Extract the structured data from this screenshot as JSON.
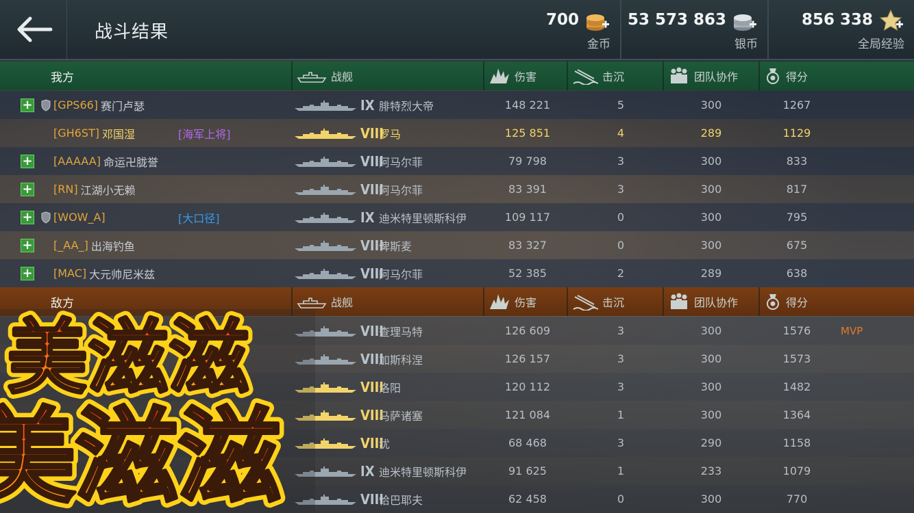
{
  "header": {
    "title": "战斗结果",
    "gold": {
      "amount": "700",
      "label": "金币"
    },
    "silver": {
      "amount": "53 573 863",
      "label": "银币"
    },
    "xp": {
      "amount": "856 338",
      "label": "全局经验"
    }
  },
  "columns": {
    "ship": "战舰",
    "damage": "伤害",
    "kills": "击沉",
    "team": "团队协作",
    "score": "得分"
  },
  "ally": {
    "team_label": "我方",
    "rows": [
      {
        "clan": "[GPS66]",
        "name": "赛门卢瑟",
        "rank": "",
        "tier": "IX",
        "ship": "腓特烈大帝",
        "damage": "148 221",
        "kills": "5",
        "team": "300",
        "score": "1267",
        "plus": true,
        "shield": true
      },
      {
        "clan": "[GH6ST]",
        "name": "邓国湿",
        "rank": "[海军上将]",
        "tier": "VIII",
        "ship": "罗马",
        "damage": "125 851",
        "kills": "4",
        "team": "289",
        "score": "1129",
        "plus": false,
        "shield": false,
        "me": true
      },
      {
        "clan": "[AAAAA]",
        "name": "命运卍胧誉",
        "rank": "",
        "tier": "VIII",
        "ship": "阿马尔菲",
        "damage": "79 798",
        "kills": "3",
        "team": "300",
        "score": "833",
        "plus": true,
        "shield": false
      },
      {
        "clan": "[RN]",
        "name": "江湖小无赖",
        "rank": "",
        "tier": "VIII",
        "ship": "阿马尔菲",
        "damage": "83 391",
        "kills": "3",
        "team": "300",
        "score": "817",
        "plus": true,
        "shield": false
      },
      {
        "clan": "[WOW_A]",
        "name": "",
        "rank": "[大口径]",
        "tier": "IX",
        "ship": "迪米特里顿斯科伊",
        "damage": "109 117",
        "kills": "0",
        "team": "300",
        "score": "795",
        "plus": true,
        "shield": true
      },
      {
        "clan": "[_AA_]",
        "name": "出海钓鱼",
        "rank": "",
        "tier": "VIII",
        "ship": "俾斯麦",
        "damage": "83 327",
        "kills": "0",
        "team": "300",
        "score": "675",
        "plus": true,
        "shield": false
      },
      {
        "clan": "[MAC]",
        "name": "大元帅尼米兹",
        "rank": "",
        "tier": "VIII",
        "ship": "阿马尔菲",
        "damage": "52 385",
        "kills": "2",
        "team": "289",
        "score": "638",
        "plus": true,
        "shield": false
      }
    ]
  },
  "enemy": {
    "team_label": "敌方",
    "rows": [
      {
        "tier": "VIII",
        "ship": "查理马特",
        "damage": "126 609",
        "kills": "3",
        "team": "300",
        "score": "1576",
        "mvp": "MVP"
      },
      {
        "tier": "VIII",
        "ship": "加斯科涅",
        "damage": "126 157",
        "kills": "3",
        "team": "300",
        "score": "1573",
        "mvp": ""
      },
      {
        "tier": "VIII",
        "ship": "洛阳",
        "damage": "120 112",
        "kills": "3",
        "team": "300",
        "score": "1482",
        "mvp": "",
        "gold": true
      },
      {
        "tier": "VIII",
        "ship": "马萨诸塞",
        "damage": "121 084",
        "kills": "1",
        "team": "300",
        "score": "1364",
        "mvp": "",
        "gold": true
      },
      {
        "tier": "VIII",
        "ship": "犹",
        "damage": "68 468",
        "kills": "3",
        "team": "290",
        "score": "1158",
        "mvp": "",
        "gold": true
      },
      {
        "tier": "IX",
        "ship": "迪米特里顿斯科伊",
        "damage": "91 625",
        "kills": "1",
        "team": "233",
        "score": "1079",
        "mvp": ""
      },
      {
        "tier": "VIII",
        "ship": "恰巴耶夫",
        "damage": "62 458",
        "kills": "0",
        "team": "300",
        "score": "770",
        "mvp": ""
      }
    ]
  },
  "sticker": {
    "text": "美滋滋"
  }
}
